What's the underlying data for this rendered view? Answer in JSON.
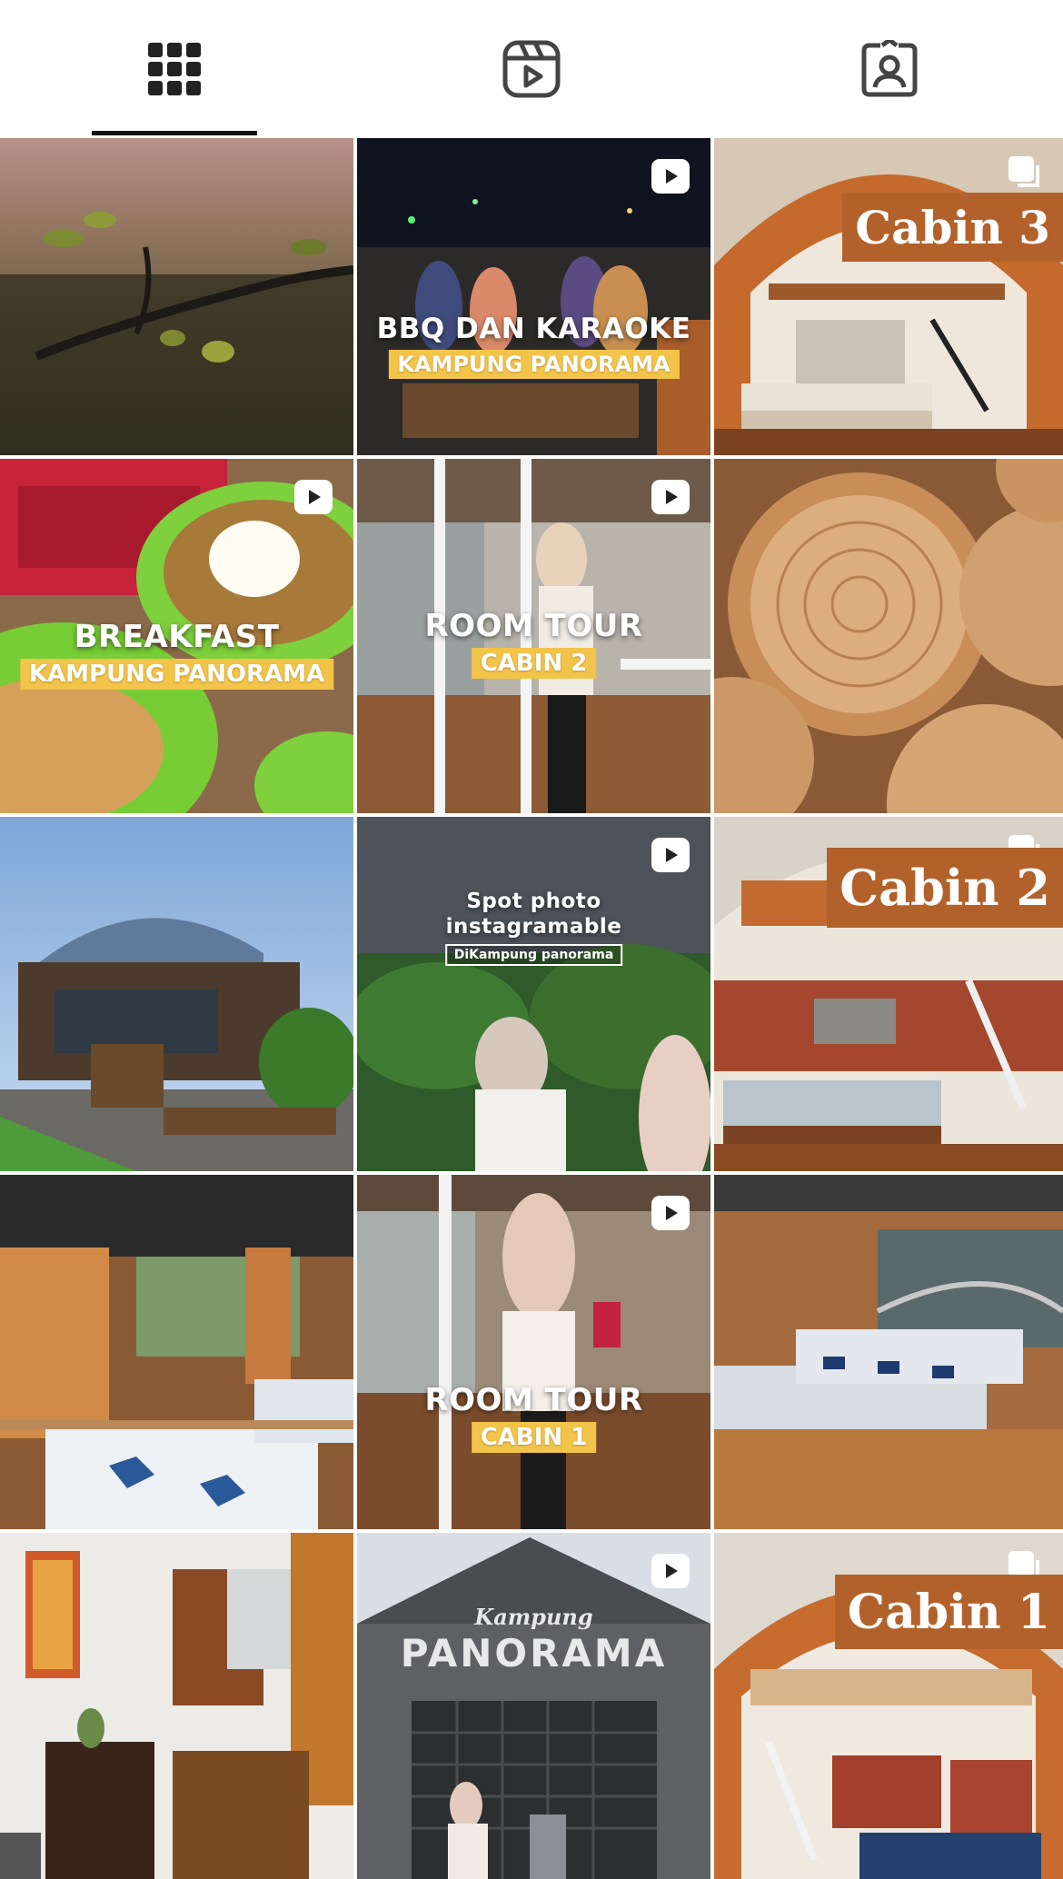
{
  "tabs": [
    {
      "name": "grid",
      "icon": "grid-icon",
      "active": true
    },
    {
      "name": "reels",
      "icon": "reels-icon",
      "active": false
    },
    {
      "name": "tagged",
      "icon": "tagged-icon",
      "active": false
    }
  ],
  "posts": [
    {
      "kind": "photo"
    },
    {
      "kind": "reel",
      "caption": "BBQ DAN KARAOKE",
      "tag": "KAMPUNG PANORAMA"
    },
    {
      "kind": "carousel",
      "label": "Cabin 3"
    },
    {
      "kind": "reel",
      "caption": "BREAKFAST",
      "tag": "KAMPUNG PANORAMA"
    },
    {
      "kind": "reel",
      "caption": "ROOM TOUR",
      "tag": "CABIN 2"
    },
    {
      "kind": "photo"
    },
    {
      "kind": "photo"
    },
    {
      "kind": "reel",
      "caption_line1": "Spot photo",
      "caption_line2": "instagramable",
      "tag": "DiKampung panorama"
    },
    {
      "kind": "carousel",
      "label": "Cabin 2"
    },
    {
      "kind": "photo"
    },
    {
      "kind": "reel",
      "caption": "ROOM TOUR",
      "tag": "CABIN 1"
    },
    {
      "kind": "photo"
    },
    {
      "kind": "photo"
    },
    {
      "kind": "reel",
      "sign_top": "Kampung",
      "sign_main": "PANORAMA"
    },
    {
      "kind": "carousel",
      "label": "Cabin 1"
    }
  ],
  "colors": {
    "accent_tag": "#f3c44a",
    "cabin_label": "#b3612b",
    "icon": "#222222"
  }
}
